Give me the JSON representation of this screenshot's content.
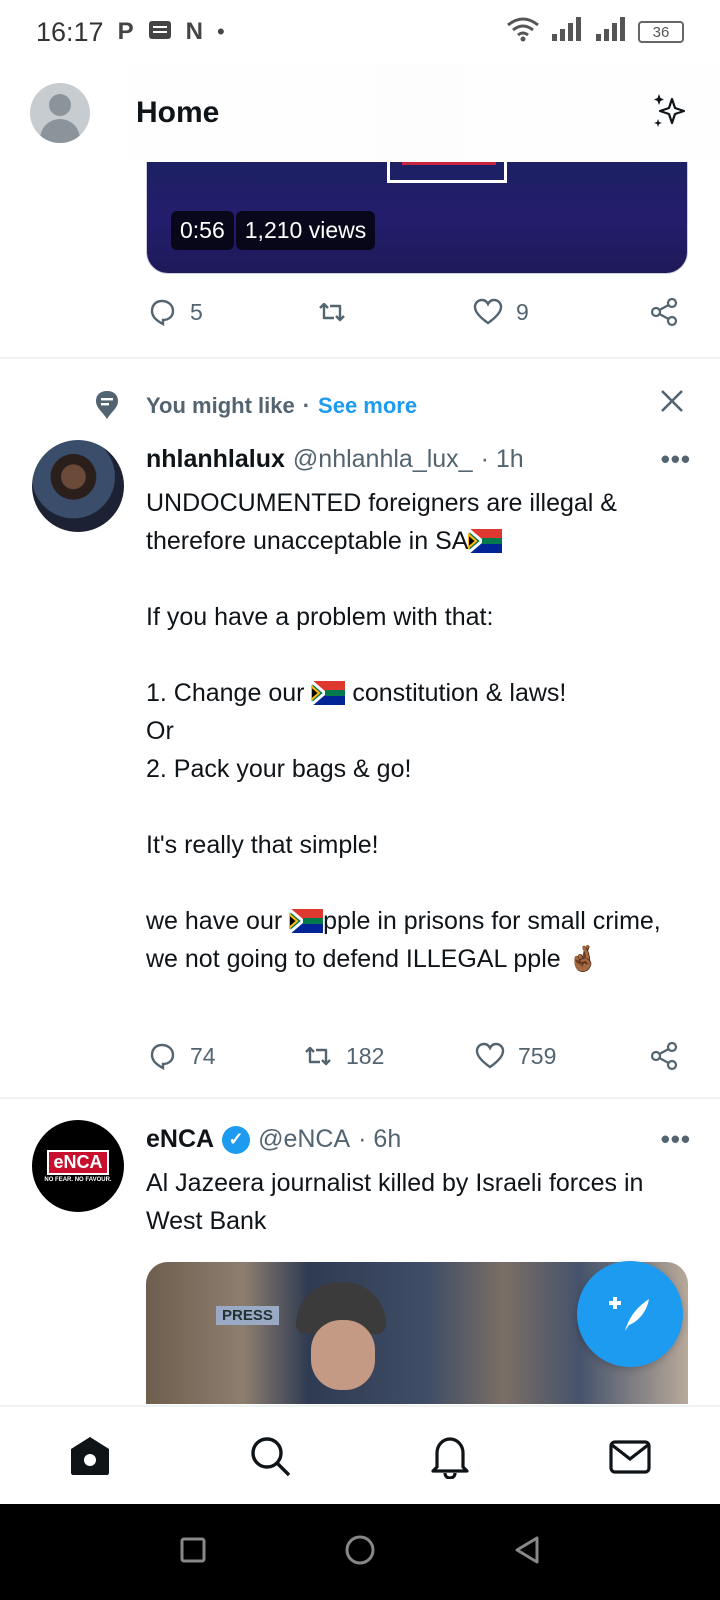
{
  "status_bar": {
    "time": "16:17",
    "notification_icons": [
      "parking-icon",
      "news-icon",
      "n-app-icon",
      "dot-icon"
    ],
    "battery": "36"
  },
  "header": {
    "title": "Home"
  },
  "video_tweet": {
    "duration": "0:56",
    "views": "1,210 views",
    "replies": "5",
    "retweets": "",
    "likes": "9"
  },
  "who_to_follow": {
    "label": "You might like",
    "separator": "·",
    "see_more": "See more"
  },
  "tweet1": {
    "name": "nhlanhlalux",
    "handle": "@nhlanhla_lux_",
    "time": "· 1h",
    "line1": "UNDOCUMENTED foreigners are illegal & therefore unacceptable in SA",
    "line2": "If you have a problem with that:",
    "line3a": "1. Change our ",
    "line3b": " constitution & laws!",
    "line4": "Or",
    "line5": "2. Pack your bags & go!",
    "line6": "It's really that simple!",
    "line7a": "we have our ",
    "line7b": "pple in prisons for small crime, we not going to defend ILLEGAL pple ",
    "emoji_crossed": "🤞🏾",
    "replies": "74",
    "retweets": "182",
    "likes": "759"
  },
  "tweet2": {
    "name": "eNCA",
    "handle": "@eNCA",
    "time": "· 6h",
    "text": "Al Jazeera journalist killed by Israeli forces in West Bank",
    "logo_text": "eNCA",
    "logo_tagline": "NO FEAR. NO FAVOUR.",
    "photo_label": "PRESS"
  },
  "more_label": "•••",
  "colors": {
    "accent": "#1d9bf0",
    "muted": "#536471",
    "text": "#0f1419"
  }
}
